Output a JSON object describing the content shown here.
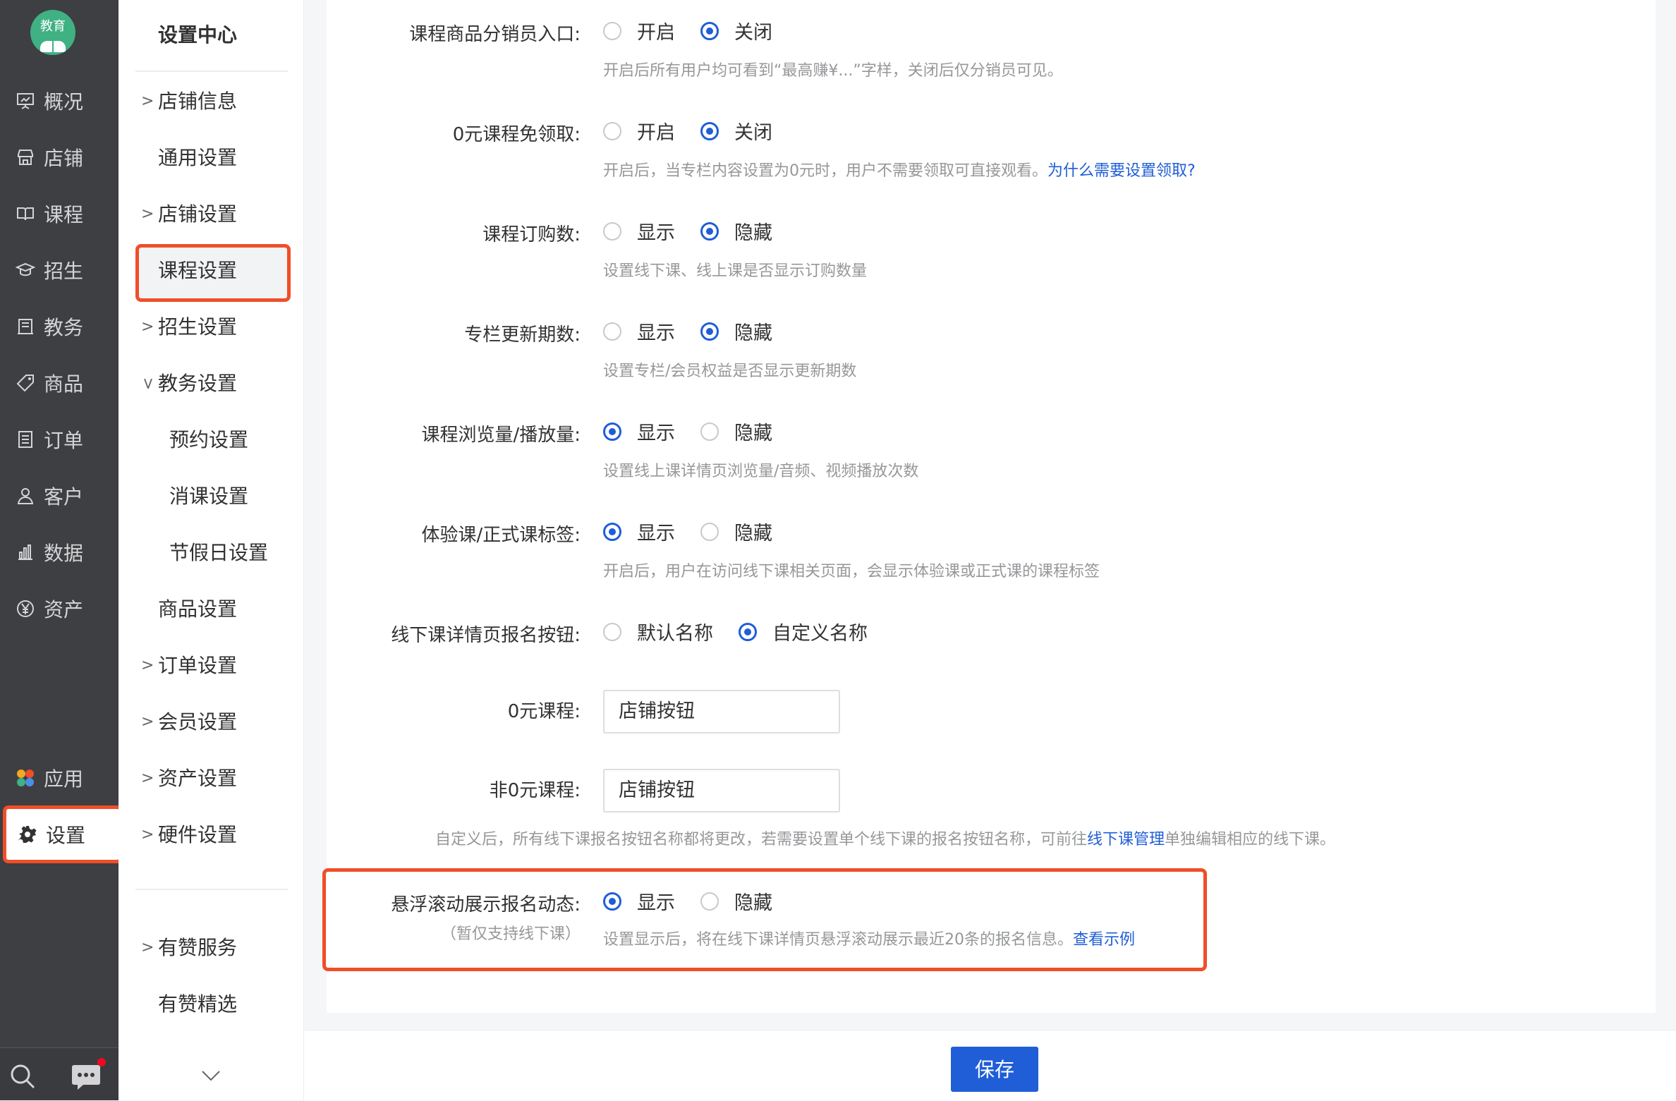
{
  "app": {
    "logo_text": "教育"
  },
  "left_nav": [
    {
      "label": "概况",
      "icon": "presentation-icon"
    },
    {
      "label": "店铺",
      "icon": "store-icon"
    },
    {
      "label": "课程",
      "icon": "book-icon"
    },
    {
      "label": "招生",
      "icon": "graduation-cap-icon"
    },
    {
      "label": "教务",
      "icon": "register-icon"
    },
    {
      "label": "商品",
      "icon": "tag-icon"
    },
    {
      "label": "订单",
      "icon": "order-list-icon"
    },
    {
      "label": "客户",
      "icon": "user-icon"
    },
    {
      "label": "数据",
      "icon": "bar-chart-icon"
    },
    {
      "label": "资产",
      "icon": "yen-icon"
    },
    {
      "label": "应用",
      "icon": "apps-icon"
    },
    {
      "label": "设置",
      "icon": "gear-icon",
      "active": true
    }
  ],
  "sub_nav": {
    "title": "设置中心",
    "items": [
      {
        "label": "店铺信息",
        "chevron": "right"
      },
      {
        "label": "通用设置"
      },
      {
        "label": "店铺设置",
        "chevron": "right"
      },
      {
        "label": "课程设置",
        "active": true
      },
      {
        "label": "招生设置",
        "chevron": "right"
      },
      {
        "label": "教务设置",
        "chevron": "down"
      },
      {
        "label": "预约设置",
        "level": 2
      },
      {
        "label": "消课设置",
        "level": 2
      },
      {
        "label": "节假日设置",
        "level": 2
      },
      {
        "label": "商品设置"
      },
      {
        "label": "订单设置",
        "chevron": "right"
      },
      {
        "label": "会员设置",
        "chevron": "right"
      },
      {
        "label": "资产设置",
        "chevron": "right"
      },
      {
        "label": "硬件设置",
        "chevron": "right"
      },
      {
        "label": "有赞服务",
        "chevron": "right"
      },
      {
        "label": "有赞精选"
      }
    ]
  },
  "settings": [
    {
      "label": "课程商品分销员入口:",
      "options": [
        "开启",
        "关闭"
      ],
      "selected": 1,
      "desc": "开启后所有用户均可看到“最高赚¥...”字样，关闭后仅分销员可见。"
    },
    {
      "label": "0元课程免领取:",
      "options": [
        "开启",
        "关闭"
      ],
      "selected": 1,
      "desc": "开启后，当专栏内容设置为0元时，用户不需要领取可直接观看。",
      "link": "为什么需要设置领取?"
    },
    {
      "label": "课程订购数:",
      "options": [
        "显示",
        "隐藏"
      ],
      "selected": 1,
      "desc": "设置线下课、线上课是否显示订购数量"
    },
    {
      "label": "专栏更新期数:",
      "options": [
        "显示",
        "隐藏"
      ],
      "selected": 1,
      "desc": "设置专栏/会员权益是否显示更新期数"
    },
    {
      "label": "课程浏览量/播放量:",
      "options": [
        "显示",
        "隐藏"
      ],
      "selected": 0,
      "desc": "设置线上课详情页浏览量/音频、视频播放次数"
    },
    {
      "label": "体验课/正式课标签:",
      "options": [
        "显示",
        "隐藏"
      ],
      "selected": 0,
      "desc": "开启后，用户在访问线下课相关页面，会显示体验课或正式课的课程标签"
    },
    {
      "label": "线下课详情页报名按钮:",
      "options": [
        "默认名称",
        "自定义名称"
      ],
      "selected": 1
    }
  ],
  "inputs": [
    {
      "label": "0元课程:",
      "value": "店铺按钮"
    },
    {
      "label": "非0元课程:",
      "value": "店铺按钮"
    }
  ],
  "custom_note": {
    "before": "自定义后，所有线下课报名按钮名称都将更改，若需要设置单个线下课的报名按钮名称，可前往",
    "link": "线下课管理",
    "after": "单独编辑相应的线下课。"
  },
  "float_setting": {
    "label": "悬浮滚动展示报名动态:",
    "sublabel": "（暂仅支持线下课）",
    "options": [
      "显示",
      "隐藏"
    ],
    "selected": 0,
    "desc": "设置显示后，将在线下课详情页悬浮滚动展示最近20条的报名信息。",
    "link": "查看示例"
  },
  "footer": {
    "save_label": "保存"
  },
  "colors": {
    "accent": "#1f5ed6",
    "highlight": "#ef4f29",
    "nav_bg": "#3e3f42"
  }
}
